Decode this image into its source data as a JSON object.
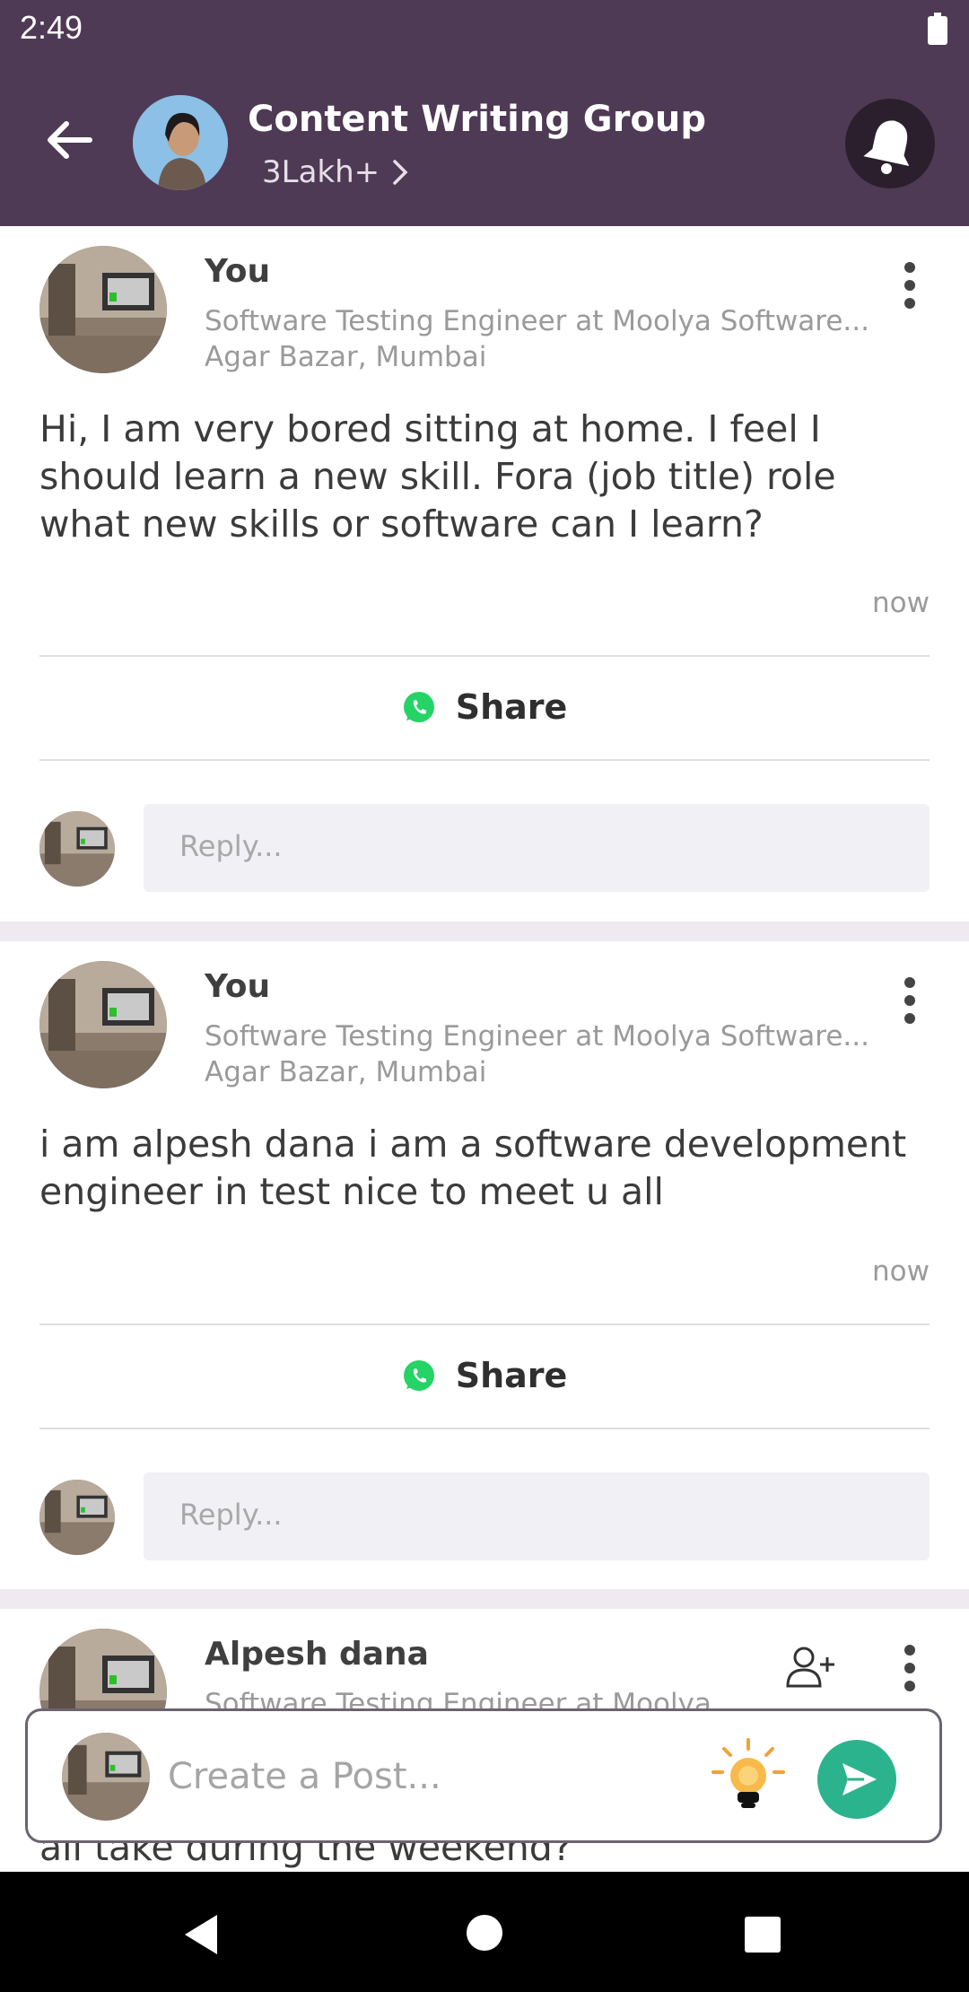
{
  "status": {
    "time": "2:49"
  },
  "header": {
    "title": "Content Writing Group",
    "members": "3Lakh+"
  },
  "posts": [
    {
      "author": "You",
      "headline": "Software Testing Engineer at Moolya Software...",
      "location": "Agar Bazar, Mumbai",
      "text": "Hi, I am very bored sitting at home. I feel I should learn a new skill. Fora (job title) role what new skills or software can I learn?",
      "time": "now",
      "share_label": "Share",
      "reply_placeholder": "Reply..."
    },
    {
      "author": "You",
      "headline": "Software Testing Engineer at Moolya Software...",
      "location": "Agar Bazar, Mumbai",
      "text": "i am alpesh dana i am a software development engineer in test nice to meet u all",
      "time": "now",
      "share_label": "Share",
      "reply_placeholder": "Reply..."
    },
    {
      "author": "Alpesh dana",
      "headline": "Software Testing Engineer at Moolya",
      "text": "all take during the weekend?"
    }
  ],
  "composer": {
    "placeholder": "Create a Post..."
  },
  "colors": {
    "header": "#4f3a55",
    "accent": "#2bb38e",
    "whatsapp": "#25d366"
  },
  "icons": [
    "back-arrow-icon",
    "bell-icon",
    "more-vert-icon",
    "whatsapp-icon",
    "add-person-icon",
    "lightbulb-icon",
    "send-icon",
    "nav-back-icon",
    "nav-home-icon",
    "nav-recents-icon",
    "battery-icon"
  ]
}
